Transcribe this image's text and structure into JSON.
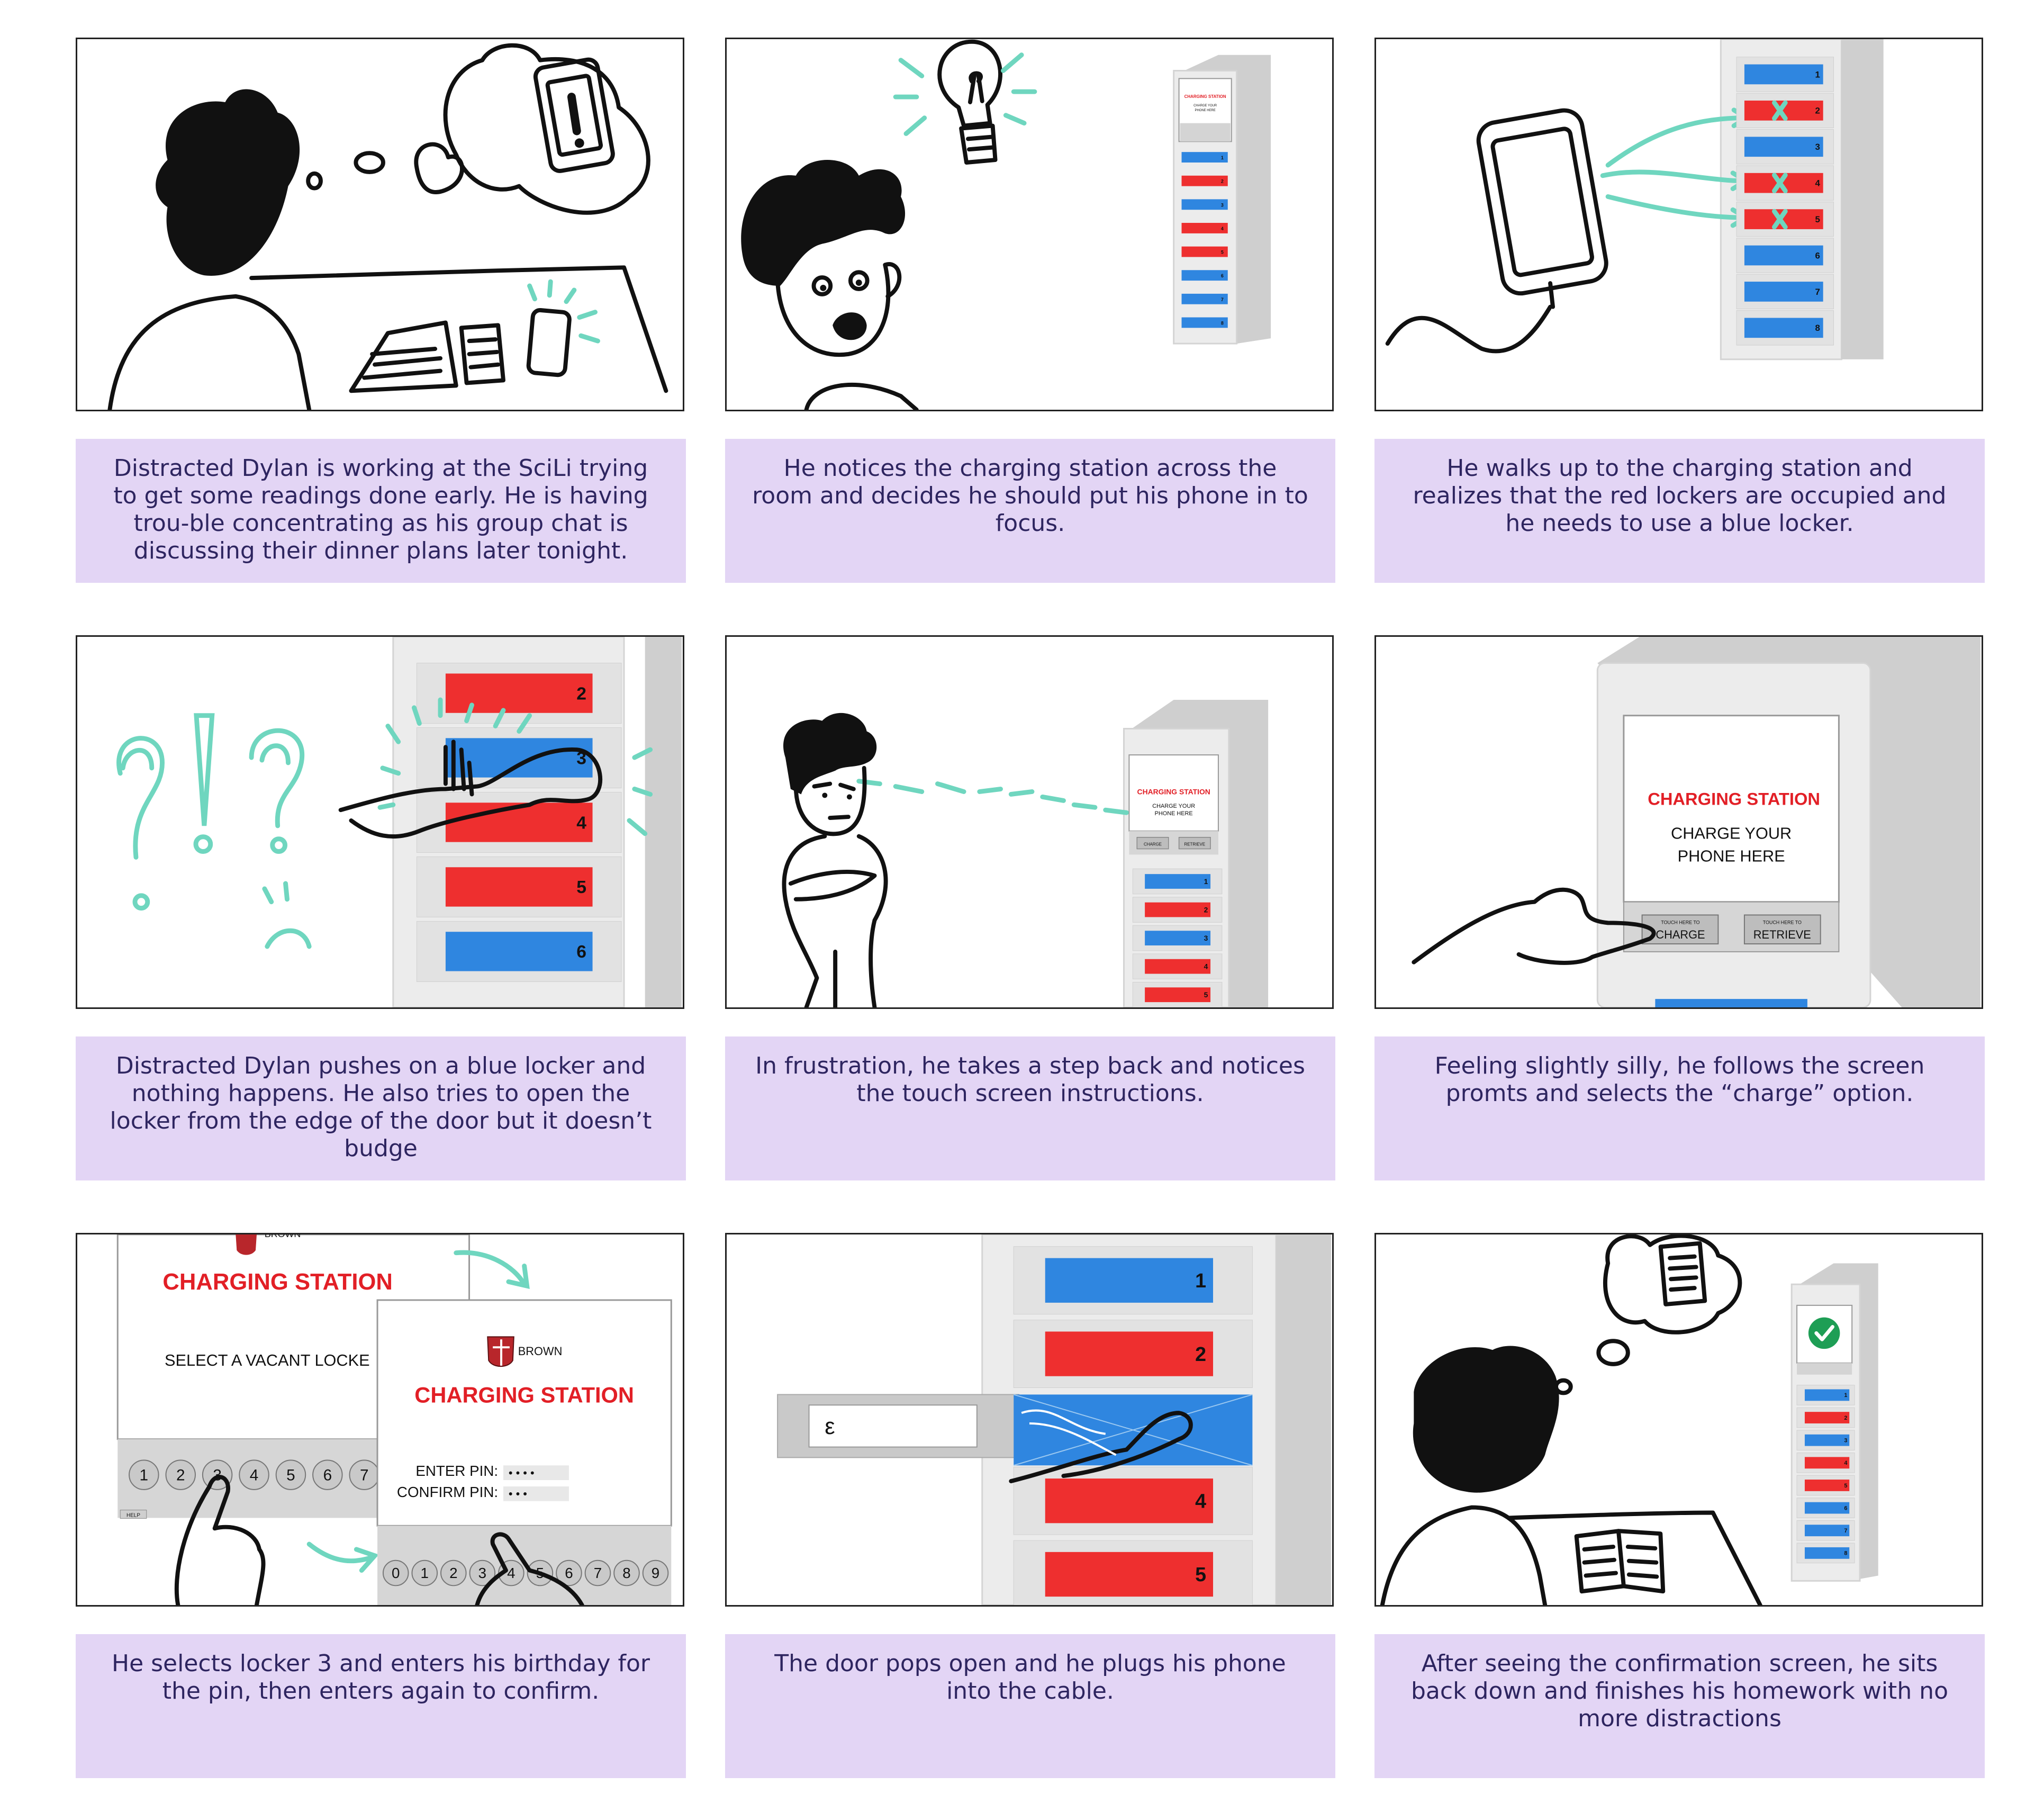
{
  "panels": [
    {
      "caption": "Distracted Dylan is working at the SciLi trying to get some readings done early. He is having trou-ble concentrating as his group chat is discussing their dinner plans later tonight."
    },
    {
      "caption": "He notices the charging station across the room and decides he should put his phone in to focus."
    },
    {
      "caption": "He walks up to the charging station and realizes that the red lockers are occupied and he needs to use a blue locker."
    },
    {
      "caption": "Distracted Dylan pushes on a blue locker and nothing happens. He also tries to open the locker from the edge of the door but it doesn’t budge"
    },
    {
      "caption": "In frustration, he takes a step back and notices the touch screen instructions."
    },
    {
      "caption": "Feeling slightly silly, he follows the screen promts and selects the “charge” option."
    },
    {
      "caption": "He selects locker 3 and enters his birthday for the pin, then enters again to confirm."
    },
    {
      "caption": "The door pops open and he plugs his phone into the cable."
    },
    {
      "caption": "After seeing the confirmation screen, he sits back down and finishes his homework with no more distractions"
    }
  ],
  "screen": {
    "title": "CHARGING STATION",
    "subtitle_line1": "CHARGE YOUR",
    "subtitle_line2": "PHONE HERE",
    "touch_hint": "TOUCH HERE TO",
    "charge": "CHARGE",
    "retrieve": "RETRIEVE",
    "select_prompt": "SELECT A VACANT LOCKE",
    "enter_pin": "ENTER PIN:",
    "confirm_pin": "CONFIRM PIN:",
    "brand": "BROWN",
    "help": "HELP",
    "slot_glyph": "ε"
  },
  "locker_numbers": [
    "1",
    "2",
    "3",
    "4",
    "5",
    "6",
    "7",
    "8"
  ],
  "keypad_digits": [
    "0",
    "1",
    "2",
    "3",
    "4",
    "5",
    "6",
    "7",
    "8",
    "9"
  ],
  "colors": {
    "caption_bg": "#e3d5f5",
    "caption_text": "#2e2560",
    "locker_blue": "#2f86e0",
    "locker_red": "#ee2f2f",
    "accent_mint": "#6fd6bf",
    "screen_red": "#e21f26"
  }
}
